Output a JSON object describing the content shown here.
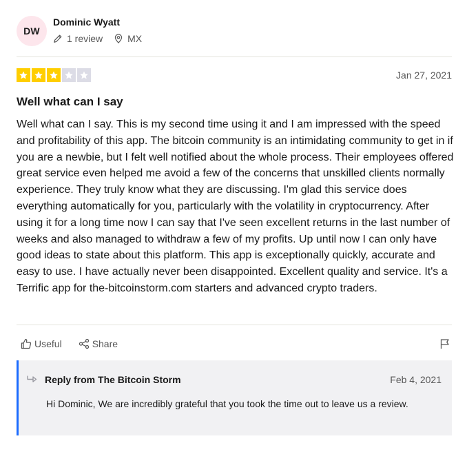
{
  "consumer": {
    "initials": "DW",
    "name": "Dominic Wyatt",
    "review_count": "1 review",
    "country": "MX"
  },
  "review": {
    "rating": 3,
    "max_rating": 5,
    "date": "Jan 27, 2021",
    "title": "Well what can I say",
    "body": "Well what can I say. This is my second time using it and I am impressed with the speed and profitability of this app. The bitcoin community is an intimidating community to get in if you are a newbie, but I felt well notified about the whole process. Their employees offered great service even helped me avoid a few of the concerns that unskilled clients normally experience. They truly know what they are discussing. I'm glad this service does everything automatically for you, particularly with the volatility in cryptocurrency. After using it for a long time now I can say that I've seen excellent returns in the last number of weeks and also managed to withdraw a few of my profits. Up until now I can only have good ideas to state about this platform. This app is exceptionally quickly, accurate and easy to use. I have actually never been disappointed. Excellent quality and service. It's a Terrific app for the-bitcoinstorm.com starters and advanced crypto traders."
  },
  "actions": {
    "useful_label": "Useful",
    "share_label": "Share"
  },
  "reply": {
    "from": "Reply from The Bitcoin Storm",
    "date": "Feb 4, 2021",
    "text": "Hi Dominic, We are incredibly grateful that you took the time out to leave us a review."
  },
  "colors": {
    "star_filled": "#ffce00",
    "star_empty": "#dcdce6",
    "reply_accent": "#1b6cff",
    "reply_background": "#f1f1f3",
    "avatar_background": "#fde6ec"
  }
}
